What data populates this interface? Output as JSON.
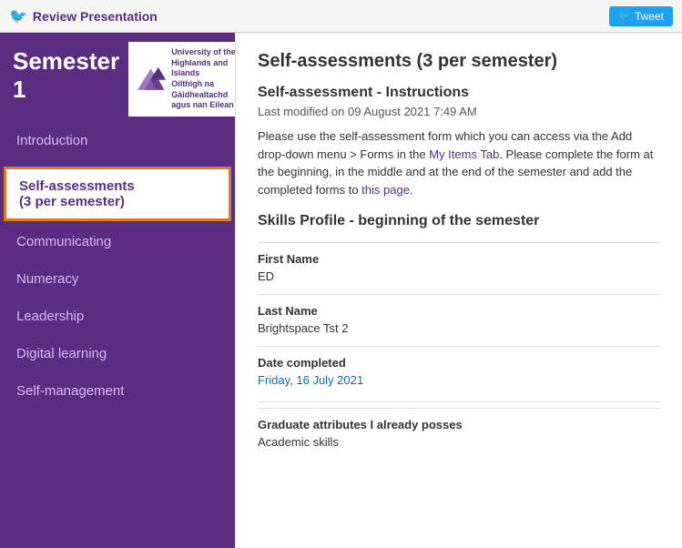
{
  "topbar": {
    "title": "Review Presentation",
    "tweet_label": "Tweet"
  },
  "sidebar": {
    "semester_label": "Semester 1",
    "logo_line1": "University of the",
    "logo_line2": "Highlands and Islands",
    "logo_line3": "Oilthigh na Gàidhealtachd",
    "logo_line4": "agus nan Eilean",
    "nav_items": [
      {
        "id": "introduction",
        "label": "Introduction",
        "active": false
      },
      {
        "id": "self-assessments",
        "label": "Self-assessments\n(3 per semester)",
        "active": true
      },
      {
        "id": "communicating",
        "label": "Communicating",
        "active": false
      },
      {
        "id": "numeracy",
        "label": "Numeracy",
        "active": false
      },
      {
        "id": "leadership",
        "label": "Leadership",
        "active": false
      },
      {
        "id": "digital-learning",
        "label": "Digital learning",
        "active": false
      },
      {
        "id": "self-management",
        "label": "Self-management",
        "active": false
      }
    ]
  },
  "content": {
    "page_title": "Self-assessments (3 per semester)",
    "section_title": "Self-assessment - Instructions",
    "last_modified": "Last modified on 09 August 2021 7:49 AM",
    "instructions": "Please use the self-assessment form which you can access via the Add drop-down menu > Forms in the My Items Tab. Please complete the form at the beginning, in the middle and at the end of the semester and add the completed forms to this page.",
    "skills_section_title": "Skills Profile - beginning of the semester",
    "fields": [
      {
        "label": "First Name",
        "value": "ED",
        "blue": false
      },
      {
        "label": "Last Name",
        "value": "Brightspace Tst 2",
        "blue": false
      },
      {
        "label": "Date completed",
        "value": "Friday, 16 July 2021",
        "blue": true
      },
      {
        "label": "Graduate attributes I already posses",
        "value": "Academic skills",
        "blue": false
      }
    ]
  }
}
